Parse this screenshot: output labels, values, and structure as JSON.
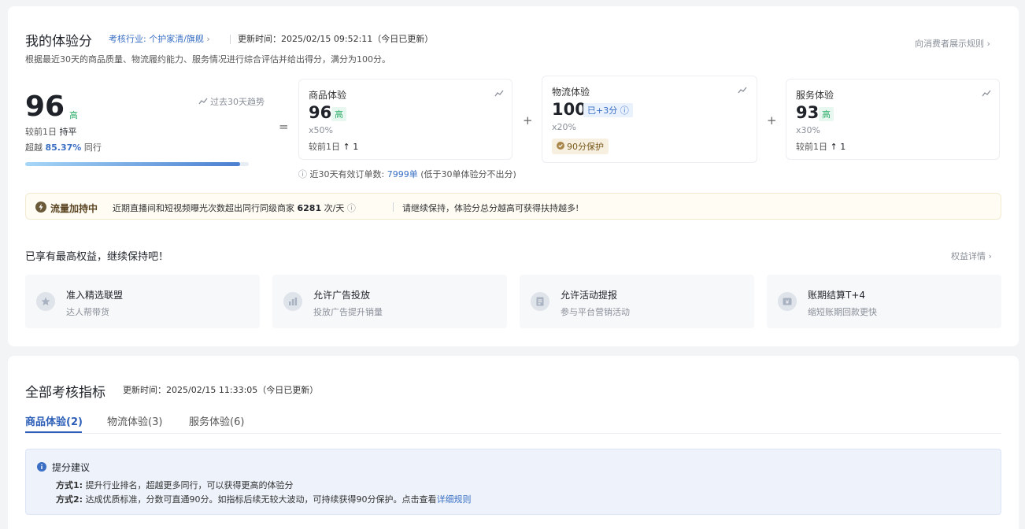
{
  "header": {
    "title": "我的体验分",
    "industry": "考核行业: 个护家清/旗舰",
    "update_time": "更新时间：2025/02/15 09:52:11（今日已更新）",
    "description": "根据最近30天的商品质量、物流履约能力、服务情况进行综合评估并给出得分，满分为100分。",
    "consumer_rule_link": "向消费者展示规则"
  },
  "total": {
    "score": "96",
    "level": "高",
    "trend_label": "过去30天趋势",
    "compare_day_label": "较前1日",
    "compare_day_value": "持平",
    "beat_prefix": "超越",
    "beat_value": "85.37%",
    "beat_suffix": "同行",
    "progress_fraction": 0.96
  },
  "operators": {
    "equals": "=",
    "plus": "+"
  },
  "subscores": {
    "product": {
      "label": "商品体验",
      "score": "96",
      "level": "高",
      "weight": "x50%",
      "compare_label": "较前1日",
      "compare_arrow": "↑",
      "compare_value": "1"
    },
    "logistics": {
      "label": "物流体验",
      "score": "100",
      "added": "已+3分",
      "weight": "x20%",
      "protect": "90分保护"
    },
    "service": {
      "label": "服务体验",
      "score": "93",
      "level": "高",
      "weight": "x30%",
      "compare_label": "较前1日",
      "compare_arrow": "↑",
      "compare_value": "1"
    }
  },
  "orders": {
    "prefix": "近30天有效订单数:",
    "value": "7999单",
    "suffix": "(低于30单体验分不出分)"
  },
  "boost": {
    "title": "流量加持中",
    "text_prefix": "近期直播间和短视频曝光次数超出同行同级商家",
    "value": "6281",
    "unit": "次/天",
    "tip": "请继续保持，体验分总分越高可获得扶持越多!"
  },
  "benefits": {
    "heading": "已享有最高权益，继续保持吧！",
    "detail_link": "权益详情",
    "items": [
      {
        "title": "准入精选联盟",
        "desc": "达人帮带货",
        "icon": "star-icon"
      },
      {
        "title": "允许广告投放",
        "desc": "投放广告提升销量",
        "icon": "ad-chart-icon"
      },
      {
        "title": "允许活动提报",
        "desc": "参与平台营销活动",
        "icon": "document-icon"
      },
      {
        "title": "账期结算T+4",
        "desc": "缩短账期回款更快",
        "icon": "yuan-icon"
      }
    ]
  },
  "metrics": {
    "title": "全部考核指标",
    "update_time": "更新时间：2025/02/15 11:33:05（今日已更新）",
    "tabs": [
      {
        "label": "商品体验(2)",
        "active": true
      },
      {
        "label": "物流体验(3)",
        "active": false
      },
      {
        "label": "服务体验(6)",
        "active": false
      }
    ],
    "tips": {
      "title": "提分建议",
      "way1_label": "方式1:",
      "way1_text": "提升行业排名，超越更多同行，可以获得更高的体验分",
      "way2_label": "方式2:",
      "way2_text": "达成优质标准，分数可直通90分。如指标后续无较大波动，可持续获得90分保护。点击查看",
      "way2_link": "详细规则"
    }
  },
  "colors": {
    "accent": "#3a6fc4",
    "high_green": "#2fae6a",
    "boost_bg": "#fffcf4",
    "tips_bg": "#eef3fb"
  }
}
